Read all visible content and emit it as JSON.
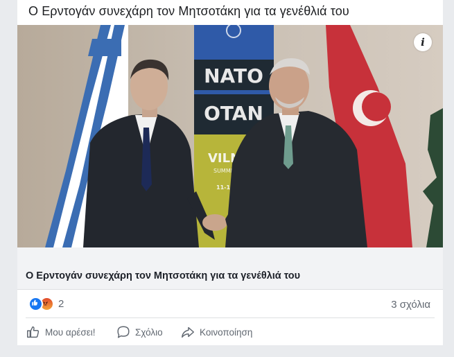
{
  "post": {
    "text": "Ο Ερντογάν συνεχάρη τον Μητσοτάκη για τα γενέθλιά του",
    "link": {
      "title": "Ο Ερντογάν συνεχάρη τον Μητσοτάκη για τα γενέθλιά του",
      "info_glyph": "i",
      "backdrop_text": {
        "nato": "NATO",
        "otan": "OTAN",
        "city": "VILNI",
        "summit": "SUMMIT | S",
        "dates": "11-12 V"
      }
    }
  },
  "stats": {
    "reaction_count": "2",
    "reaction_types": [
      "like-icon",
      "angry-icon"
    ],
    "comments": "3 σχόλια"
  },
  "actions": {
    "like_label": "Μου αρέσει!",
    "comment_label": "Σχόλιο",
    "share_label": "Κοινοποίηση"
  },
  "colors": {
    "like_blue": "#1877f2",
    "text_secondary": "#606770",
    "caption_bg": "#f2f3f5"
  }
}
